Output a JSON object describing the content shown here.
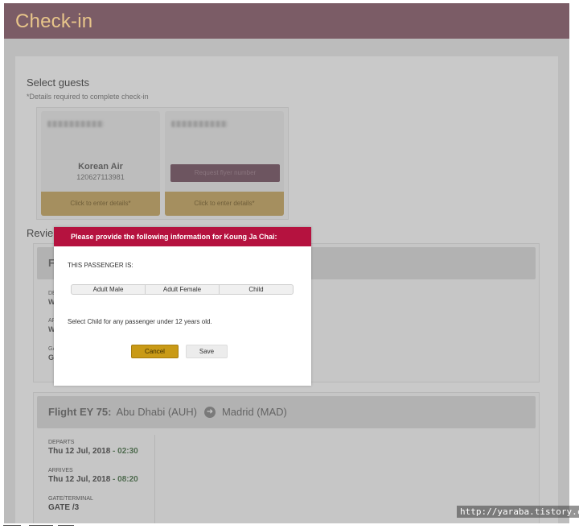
{
  "header": {
    "title": "Check-in"
  },
  "select_guests": {
    "title": "Select guests",
    "subtitle": "*Details required to complete check-in",
    "cards": [
      {
        "airline": "Korean Air",
        "number": "120627113981",
        "details_button": "Click to enter details*"
      },
      {
        "frequent_flyer_button": "Request flyer number",
        "details_button": "Click to enter details*"
      }
    ]
  },
  "review": {
    "title": "Revie"
  },
  "flights": [
    {
      "letter": "F",
      "abbr": [
        "DE",
        "W",
        "AR",
        "W",
        "GATE",
        "G"
      ]
    },
    {
      "flight_no": "Flight EY 75:",
      "origin": "Abu Dhabi (AUH)",
      "destination": "Madrid (MAD)",
      "departs_label": "DEPARTS",
      "departs_date": "Thu 12 Jul, 2018",
      "departs_sep": "-",
      "departs_time": "02:30",
      "arrives_label": "ARRIVES",
      "arrives_date": "Thu 12 Jul, 2018",
      "arrives_sep": "-",
      "arrives_time": "08:20",
      "gate_label": "GATE/TERMINAL",
      "gate_value": "GATE /3"
    }
  ],
  "modal": {
    "title": "Please provide the following information for Koung Ja Chai:",
    "label": "THIS PASSENGER IS:",
    "options": [
      "Adult Male",
      "Adult Female",
      "Child"
    ],
    "note": "Select Child for any passenger under 12 years old.",
    "cancel_label": "Cancel",
    "save_label": "Save"
  },
  "watermark": "http://yaraba.tistory.com",
  "colors": {
    "header_bg": "#7b5c66",
    "header_title": "#e8c58a",
    "modal_header": "#b5123f",
    "cancel_button": "#c99a16",
    "details_button": "#a58f5f"
  }
}
